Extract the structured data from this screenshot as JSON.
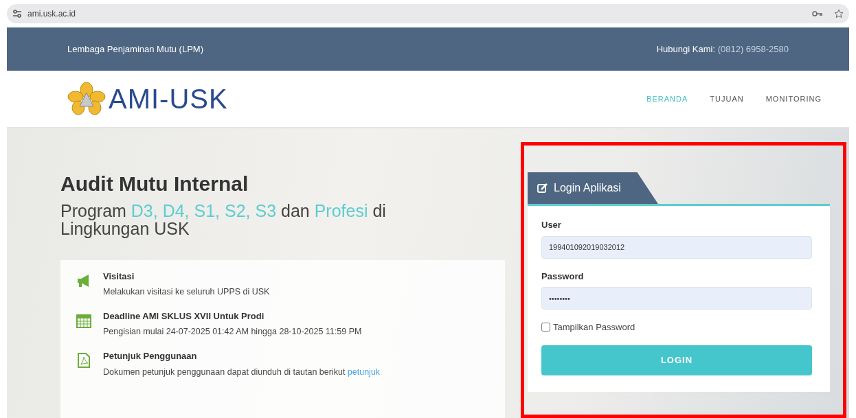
{
  "browser": {
    "url": "ami.usk.ac.id"
  },
  "topbar": {
    "left": "Lembaga Penjaminan Mutu (LPM)",
    "contact_label": "Hubungi Kami:",
    "contact_value": "(0812) 6958-2580"
  },
  "header": {
    "logo_text": "AMI-USK",
    "nav": [
      {
        "label": "BERANDA",
        "selected": true
      },
      {
        "label": "TUJUAN",
        "selected": false
      },
      {
        "label": "MONITORING",
        "selected": false
      }
    ]
  },
  "hero": {
    "title": "Audit Mutu Internal",
    "subtitle": [
      {
        "text": "Program ",
        "highlight": false
      },
      {
        "text": "D3, D4, S1, S2, S3",
        "highlight": true
      },
      {
        "text": " dan ",
        "highlight": false
      },
      {
        "text": "Profesi",
        "highlight": true
      },
      {
        "text": " di Lingkungan USK",
        "highlight": false
      }
    ]
  },
  "info": [
    {
      "kind": "megaphone",
      "title": "Visitasi",
      "text": "Melakukan visitasi ke seluruh UPPS di USK"
    },
    {
      "kind": "calendar",
      "title": "Deadline AMI SKLUS XVII Untuk Prodi",
      "text": "Pengisian mulai 24-07-2025 01:42 AM hingga 28-10-2025 11:59 PM"
    },
    {
      "kind": "document",
      "title": "Petunjuk Penggunaan",
      "text": "Dokumen petunjuk penggunaan dapat diunduh di tautan berikut",
      "link": "petunjuk"
    }
  ],
  "login": {
    "tab": "Login Aplikasi",
    "user_label": "User",
    "user_value": "199401092019032012",
    "password_label": "Password",
    "password_value": "••••••••",
    "show_password": {
      "label": "Tampilkan Password",
      "checked": false
    },
    "button": "LOGIN"
  },
  "annotation": {
    "color": "#ff0000"
  }
}
